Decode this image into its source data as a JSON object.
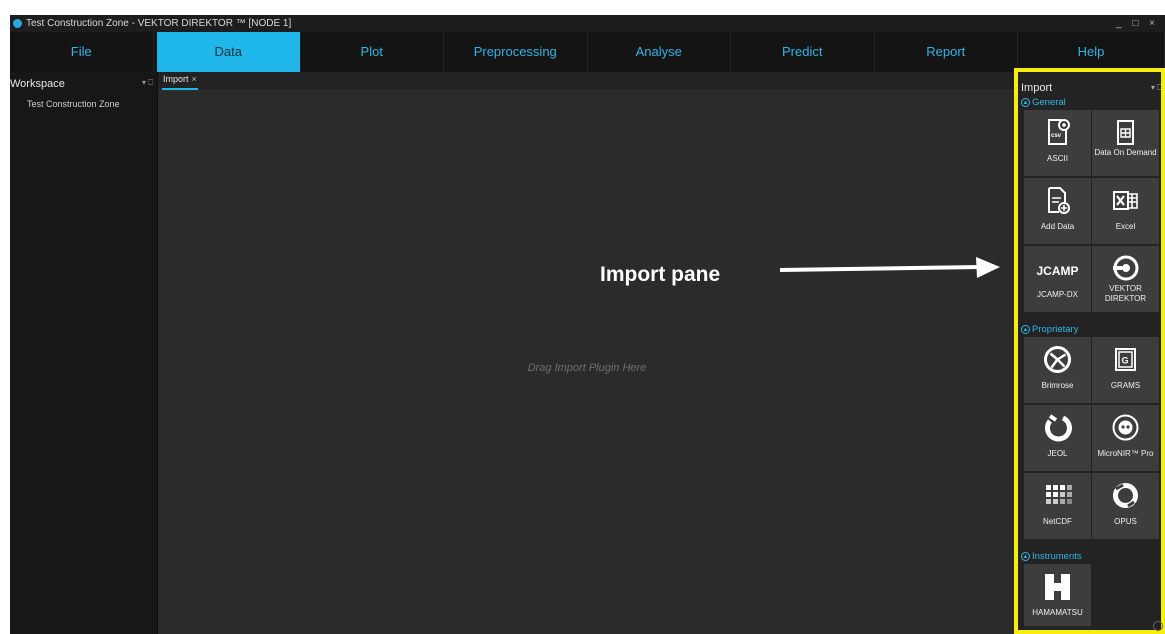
{
  "window": {
    "title": "Test Construction Zone - VEKTOR DIREKTOR ™ [NODE 1]",
    "controls": "_ □ ×"
  },
  "menu": [
    "File",
    "Data",
    "Plot",
    "Preprocessing",
    "Analyse",
    "Predict",
    "Report",
    "Help"
  ],
  "menu_active": "Data",
  "workspace": {
    "title": "Workspace",
    "pin": "▾ ⎕",
    "item": "Test Construction Zone"
  },
  "center": {
    "tab_label": "Import",
    "tab_close": "×",
    "placeholder": "Drag Import Plugin Here"
  },
  "annotation": {
    "label": "Import pane"
  },
  "import_panel": {
    "title": "Import",
    "pin": "▾ ⎕",
    "sections": {
      "general": "General",
      "proprietary": "Proprietary",
      "instruments": "Instruments"
    },
    "tiles": {
      "ascii": "ASCII",
      "data_on_demand": "Data On Demand",
      "add_data": "Add Data",
      "excel": "Excel",
      "jcamp_icon": "JCAMP",
      "jcamp_dx": "JCAMP-DX",
      "vektor_direktor": "VEKTOR DIREKTOR",
      "brimrose": "Brimrose",
      "grams": "GRAMS",
      "jeol": "JEOL",
      "micronir": "MicroNIR™ Pro",
      "netcdf": "NetCDF",
      "opus": "OPUS",
      "hamamatsu": "HAMAMATSU"
    }
  },
  "colors": {
    "accent": "#1fb7ea",
    "highlight_box": "#f7ee0f",
    "tile_bg": "#3d3d3d"
  }
}
